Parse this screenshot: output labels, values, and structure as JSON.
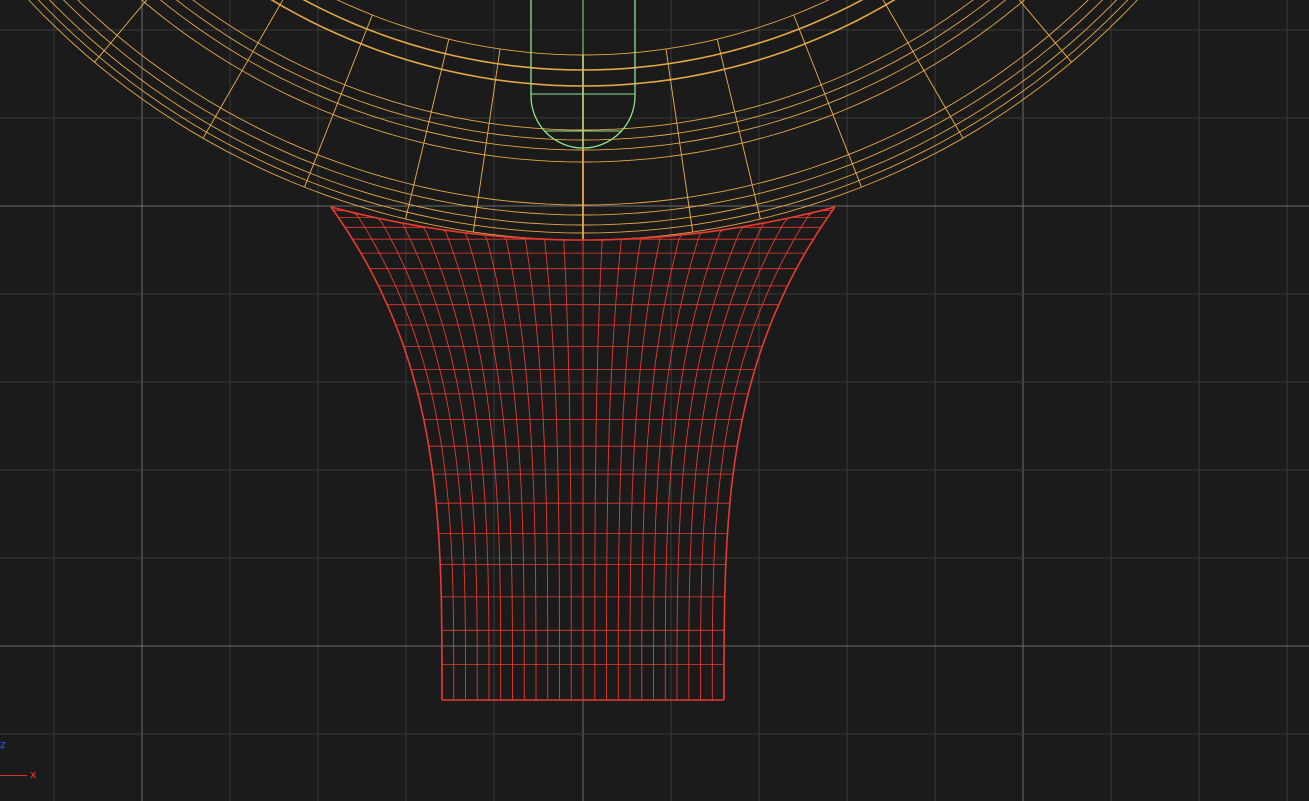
{
  "viewport": {
    "background": "#1b1b1b",
    "grid_minor_color": "#3a3a3a",
    "grid_major_color": "#6e6e6e"
  },
  "objects": {
    "wheel_rim": {
      "color": "#f0b04a"
    },
    "handle_slot": {
      "color": "#8fe08f"
    },
    "flared_mesh": {
      "color": "#e83a30"
    }
  },
  "axis_gizmo": {
    "z_label": "z",
    "x_label": "x",
    "z_color": "#3355ff",
    "x_color": "#ff3333"
  }
}
